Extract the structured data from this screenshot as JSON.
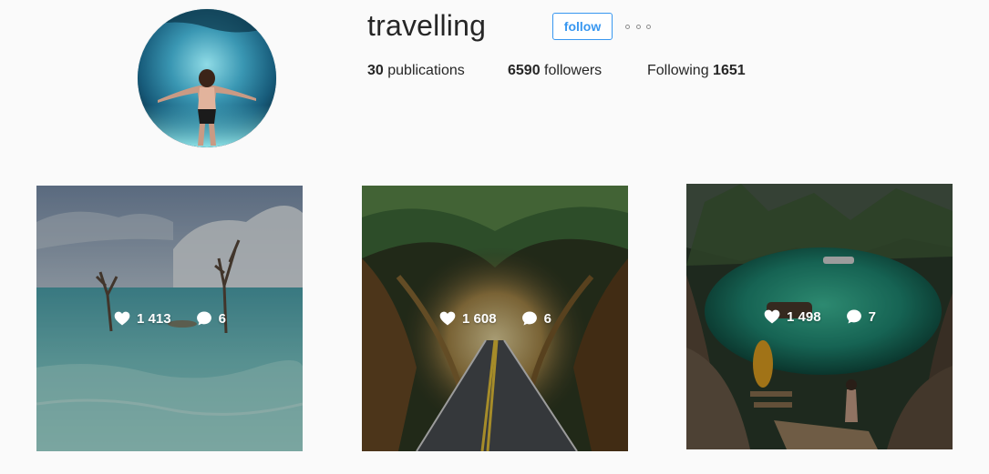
{
  "profile": {
    "username": "travelling",
    "follow_label": "follow",
    "more_icon": "ellipsis-icon",
    "avatar_icon": "swimmer-underwater-avatar",
    "stats": {
      "publications_count": "30",
      "publications_label": "publications",
      "followers_count": "6590",
      "followers_label": "followers",
      "following_label": "Following",
      "following_count": "1651"
    }
  },
  "posts": [
    {
      "likes": "1 413",
      "comments": "6",
      "image": "sea-with-dead-trees"
    },
    {
      "likes": "1 608",
      "comments": "6",
      "image": "tree-tunnel-road"
    },
    {
      "likes": "1 498",
      "comments": "7",
      "image": "lagoon-with-kayak"
    }
  ],
  "colors": {
    "accent": "#3897f0",
    "text": "#262626",
    "background": "#fafafa"
  }
}
